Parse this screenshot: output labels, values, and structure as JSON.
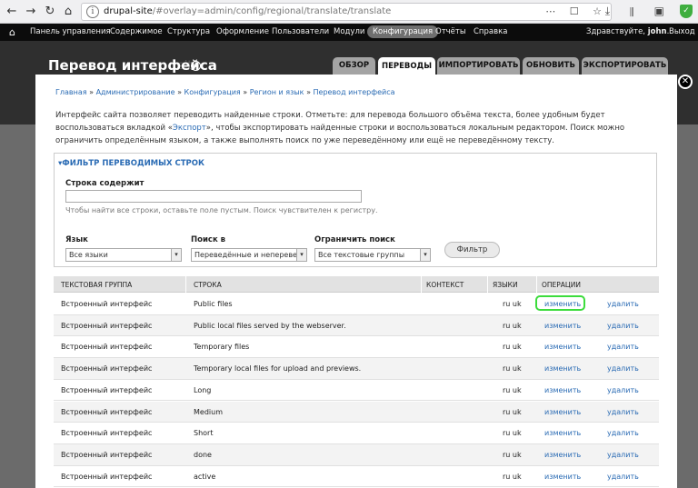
{
  "browser": {
    "url_host": "drupal-site",
    "url_path": "/#overlay=admin/config/regional/translate/translate",
    "back_glyph": "←",
    "forward_glyph": "→",
    "reload_glyph": "↻",
    "home_glyph": "⌂",
    "info_glyph": "i",
    "url_actions_glyphs": "⋯ ☐ ☆",
    "toolbar_glyphs": "⤓ ⫴ ▣",
    "extension_glyph": "✓"
  },
  "admin_bar": {
    "home_glyph": "⌂",
    "items": [
      {
        "label": "Панель управления",
        "active": false
      },
      {
        "label": "Содержимое",
        "active": false
      },
      {
        "label": "Структура",
        "active": false
      },
      {
        "label": "Оформление",
        "active": false
      },
      {
        "label": "Пользователи",
        "active": false
      },
      {
        "label": "Модули",
        "active": false
      },
      {
        "label": "Конфигурация",
        "active": true
      },
      {
        "label": "Отчёты",
        "active": false
      },
      {
        "label": "Справка",
        "active": false
      }
    ],
    "greeting_prefix": "Здравствуйте, ",
    "username": "john",
    "greeting_suffix": ".",
    "logout": "Выход"
  },
  "overlay": {
    "background_site": "site",
    "title": "Перевод интерфейса",
    "shortcut_glyph": "+",
    "close_glyph": "✕",
    "tabs": [
      {
        "label": "ОБЗОР",
        "active": false
      },
      {
        "label": "ПЕРЕВОДЫ",
        "active": true
      },
      {
        "label": "ИМПОРТИРОВАТЬ",
        "active": false
      },
      {
        "label": "ОБНОВИТЬ",
        "active": false
      },
      {
        "label": "ЭКСПОРТИРОВАТЬ",
        "active": false
      }
    ]
  },
  "breadcrumb": {
    "items": [
      "Главная",
      "Администрирование",
      "Конфигурация",
      "Регион и язык",
      "Перевод интерфейса"
    ],
    "separator": "»"
  },
  "description": {
    "part1": "Интерфейс сайта позволяет переводить найденные строки. Отметьте: для перевода большого объёма текста, более удобным будет воспользоваться вкладкой «",
    "link": "Экспорт",
    "part2": "», чтобы экспортировать найденные строки и воспользоваться локальным редактором. Поиск можно ограничить определённым языком, а также выполнять поиск по уже переведённому или ещё не переведённому тексту."
  },
  "filter": {
    "legend": "▾ФИЛЬТР ПЕРЕВОДИМЫХ СТРОК",
    "string_label": "Строка содержит",
    "string_value": "",
    "string_hint": "Чтобы найти все строки, оставьте поле пустым. Поиск чувствителен к регистру.",
    "language_label": "Язык",
    "language_value": "Все языки",
    "search_in_label": "Поиск в",
    "search_in_value": "Переведённые и неперевед",
    "limit_label": "Ограничить поиск",
    "limit_value": "Все текстовые группы",
    "select_arrow": "▾",
    "button": "Фильтр"
  },
  "table": {
    "headers": [
      "ТЕКСТОВАЯ ГРУППА",
      "СТРОКА",
      "КОНТЕКСТ",
      "ЯЗЫКИ",
      "ОПЕРАЦИИ"
    ],
    "edit_label": "изменить",
    "delete_label": "удалить",
    "rows": [
      {
        "group": "Встроенный интерфейс",
        "string": "Public files",
        "context": "",
        "languages": "ru uk"
      },
      {
        "group": "Встроенный интерфейс",
        "string": "Public local files served by the webserver.",
        "context": "",
        "languages": "ru uk"
      },
      {
        "group": "Встроенный интерфейс",
        "string": "Temporary files",
        "context": "",
        "languages": "ru uk"
      },
      {
        "group": "Встроенный интерфейс",
        "string": "Temporary local files for upload and previews.",
        "context": "",
        "languages": "ru uk"
      },
      {
        "group": "Встроенный интерфейс",
        "string": "Long",
        "context": "",
        "languages": "ru uk"
      },
      {
        "group": "Встроенный интерфейс",
        "string": "Medium",
        "context": "",
        "languages": "ru uk"
      },
      {
        "group": "Встроенный интерфейс",
        "string": "Short",
        "context": "",
        "languages": "ru uk"
      },
      {
        "group": "Встроенный интерфейс",
        "string": "done",
        "context": "",
        "languages": "ru uk"
      },
      {
        "group": "Встроенный интерфейс",
        "string": "active",
        "context": "",
        "languages": "ru uk"
      }
    ]
  },
  "colors": {
    "link": "#2a6bb4",
    "highlight": "#3cdc3c",
    "admin_bar": "#0c0c0c",
    "overlay_header": "#2f2f2f"
  }
}
